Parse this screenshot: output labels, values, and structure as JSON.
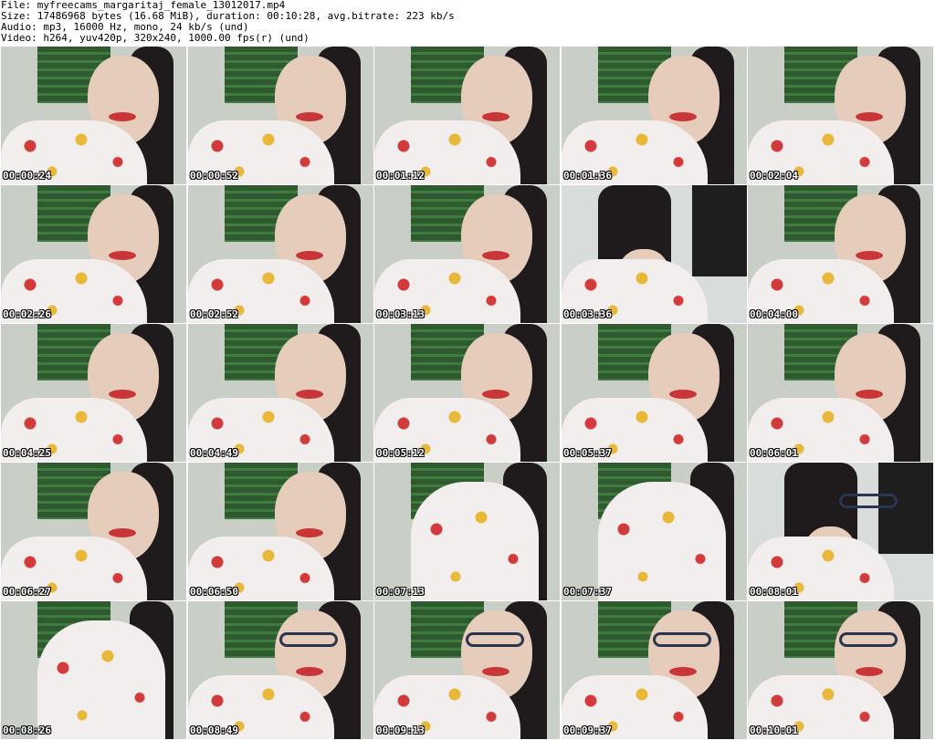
{
  "header": {
    "file": "File: myfreecams_margaritaj_female_13012017.mp4",
    "size": "Size: 17486968 bytes (16.68 MiB), duration: 00:10:28, avg.bitrate: 223 kb/s",
    "audio": "Audio: mp3, 16000 Hz, mono, 24 kb/s (und)",
    "video": "Video: h264, yuv420p, 320x240, 1000.00 fps(r) (und)"
  },
  "thumbnails": [
    {
      "timestamp": "00:00:24",
      "variant": "face",
      "glasses": false
    },
    {
      "timestamp": "00:00:52",
      "variant": "face",
      "glasses": false
    },
    {
      "timestamp": "00:01:12",
      "variant": "face",
      "glasses": false
    },
    {
      "timestamp": "00:01:36",
      "variant": "face",
      "glasses": false
    },
    {
      "timestamp": "00:02:04",
      "variant": "face",
      "glasses": false
    },
    {
      "timestamp": "00:02:26",
      "variant": "face",
      "glasses": false
    },
    {
      "timestamp": "00:02:52",
      "variant": "face",
      "glasses": false
    },
    {
      "timestamp": "00:03:13",
      "variant": "face",
      "glasses": false
    },
    {
      "timestamp": "00:03:36",
      "variant": "room",
      "glasses": false
    },
    {
      "timestamp": "00:04:00",
      "variant": "face",
      "glasses": false
    },
    {
      "timestamp": "00:04:25",
      "variant": "face",
      "glasses": false
    },
    {
      "timestamp": "00:04:49",
      "variant": "face",
      "glasses": false
    },
    {
      "timestamp": "00:05:12",
      "variant": "face",
      "glasses": false
    },
    {
      "timestamp": "00:05:37",
      "variant": "face",
      "glasses": false
    },
    {
      "timestamp": "00:06:01",
      "variant": "face",
      "glasses": false
    },
    {
      "timestamp": "00:06:27",
      "variant": "face",
      "glasses": false
    },
    {
      "timestamp": "00:06:50",
      "variant": "face",
      "glasses": false
    },
    {
      "timestamp": "00:07:13",
      "variant": "body",
      "glasses": false
    },
    {
      "timestamp": "00:07:37",
      "variant": "body",
      "glasses": false
    },
    {
      "timestamp": "00:08:01",
      "variant": "room",
      "glasses": true
    },
    {
      "timestamp": "00:08:26",
      "variant": "body",
      "glasses": false
    },
    {
      "timestamp": "00:08:49",
      "variant": "face",
      "glasses": true
    },
    {
      "timestamp": "00:09:13",
      "variant": "face",
      "glasses": true
    },
    {
      "timestamp": "00:09:37",
      "variant": "face",
      "glasses": true
    },
    {
      "timestamp": "00:10:01",
      "variant": "face",
      "glasses": true
    }
  ]
}
